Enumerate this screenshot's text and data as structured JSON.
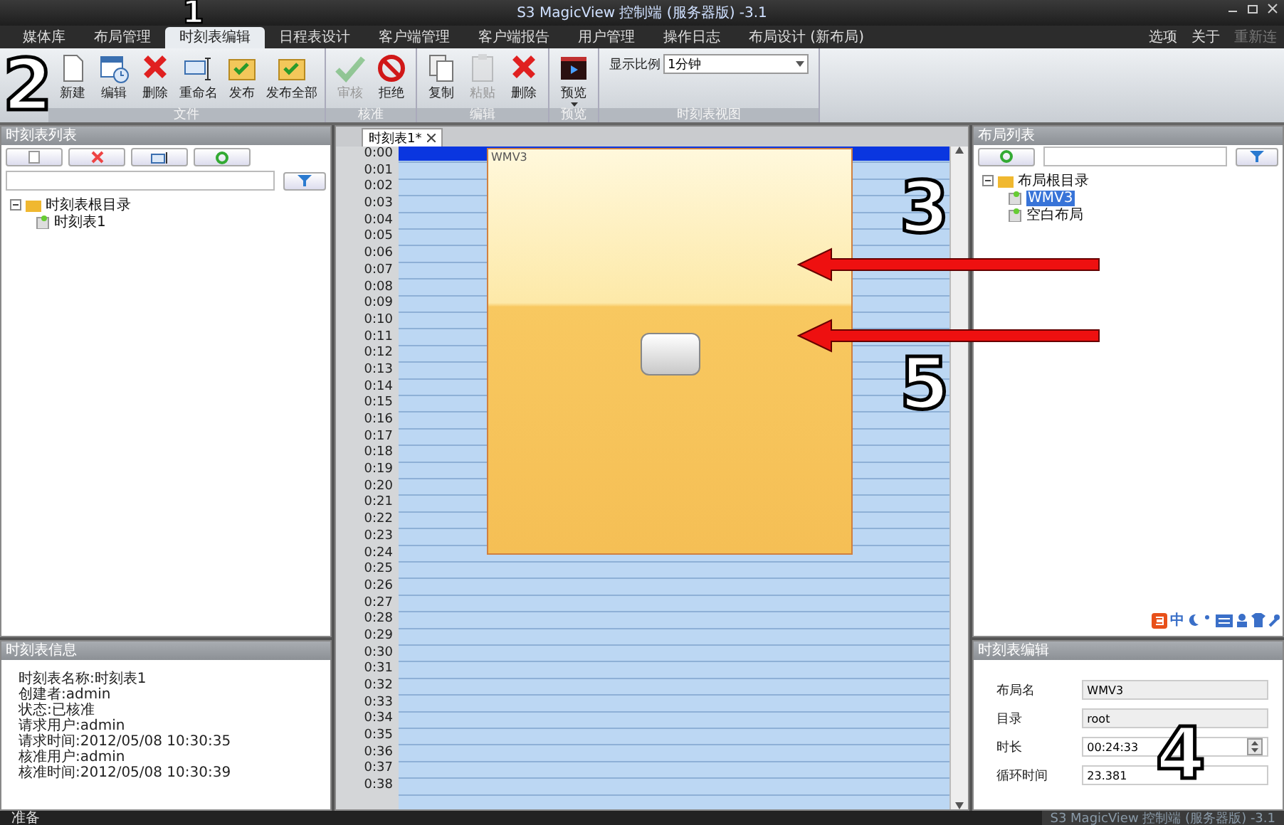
{
  "window": {
    "title": "S3 MagicView 控制端 (服务器版) -3.1"
  },
  "tabs": [
    {
      "label": "媒体库",
      "selected": false
    },
    {
      "label": "布局管理",
      "selected": false
    },
    {
      "label": "时刻表编辑",
      "selected": true
    },
    {
      "label": "日程表设计",
      "selected": false
    },
    {
      "label": "客户端管理",
      "selected": false
    },
    {
      "label": "客户端报告",
      "selected": false
    },
    {
      "label": "用户管理",
      "selected": false
    },
    {
      "label": "操作日志",
      "selected": false
    },
    {
      "label": "布局设计 (新布局)",
      "selected": false
    }
  ],
  "menu_right": [
    {
      "label": "选项",
      "disabled": false
    },
    {
      "label": "关于",
      "disabled": false
    },
    {
      "label": "重新连",
      "disabled": true
    }
  ],
  "ribbon": [
    {
      "label": "文件",
      "buttons": [
        {
          "label": "新建",
          "kind": "new",
          "disabled": false
        },
        {
          "label": "编辑",
          "kind": "edit",
          "disabled": false
        },
        {
          "label": "删除",
          "kind": "delete",
          "disabled": false
        },
        {
          "label": "重命名",
          "kind": "rename",
          "disabled": false
        },
        {
          "label": "发布",
          "kind": "publish",
          "disabled": false
        },
        {
          "label": "发布全部",
          "kind": "publish",
          "disabled": false
        }
      ]
    },
    {
      "label": "核准",
      "buttons": [
        {
          "label": "审核",
          "kind": "approve",
          "disabled": true
        },
        {
          "label": "拒绝",
          "kind": "reject",
          "disabled": false
        }
      ]
    },
    {
      "label": "编辑",
      "buttons": [
        {
          "label": "复制",
          "kind": "copy",
          "disabled": false
        },
        {
          "label": "粘贴",
          "kind": "paste",
          "disabled": true
        },
        {
          "label": "删除",
          "kind": "delete",
          "disabled": false
        }
      ]
    },
    {
      "label": "预览",
      "buttons": [
        {
          "label": "预览",
          "kind": "preview",
          "disabled": false
        }
      ]
    },
    {
      "label": "时刻表视图",
      "select": {
        "label": "显示比例",
        "value": "1分钟"
      }
    }
  ],
  "schedule_list": {
    "title": "时刻表列表",
    "tree": [
      {
        "label": "时刻表根目录",
        "expanded": true,
        "children": [
          {
            "label": "时刻表1",
            "selected": false
          }
        ]
      }
    ]
  },
  "schedule_info": {
    "title": "时刻表信息",
    "lines": [
      "时刻表名称:时刻表1",
      "创建者:admin",
      "状态:已核准",
      "请求用户:admin",
      "请求时间:2012/05/08 10:30:35",
      "核准用户:admin",
      "核准时间:2012/05/08 10:30:39"
    ]
  },
  "editor": {
    "tab": "时刻表1*",
    "times": [
      "0:00",
      "0:01",
      "0:02",
      "0:03",
      "0:04",
      "0:05",
      "0:06",
      "0:07",
      "0:08",
      "0:09",
      "0:10",
      "0:11",
      "0:12",
      "0:13",
      "0:14",
      "0:15",
      "0:16",
      "0:17",
      "0:18",
      "0:19",
      "0:20",
      "0:21",
      "0:22",
      "0:23",
      "0:24",
      "0:25",
      "0:26",
      "0:27",
      "0:28",
      "0:29",
      "0:30",
      "0:31",
      "0:32",
      "0:33",
      "0:34",
      "0:35",
      "0:36",
      "0:37",
      "0:38"
    ],
    "block": {
      "label": "WMV3"
    }
  },
  "layout_list": {
    "title": "布局列表",
    "tree": [
      {
        "label": "布局根目录",
        "expanded": true,
        "children": [
          {
            "label": "WMV3",
            "selected": true
          },
          {
            "label": "空白布局",
            "selected": false
          }
        ]
      }
    ]
  },
  "ime_bar": {
    "label": "中"
  },
  "schedule_edit": {
    "title": "时刻表编辑",
    "fields": [
      {
        "label": "布局名",
        "value": "WMV3",
        "kind": "readonly"
      },
      {
        "label": "目录",
        "value": "root",
        "kind": "readonly"
      },
      {
        "label": "时长",
        "value": "00:24:33",
        "kind": "spinner"
      },
      {
        "label": "循环时间",
        "value": "23.381",
        "kind": "text"
      }
    ]
  },
  "status_bar": {
    "left": "准备",
    "right": "S3 MagicView 控制端 (服务器版) -3.1"
  },
  "annotations": [
    {
      "kind": "number",
      "text": "1"
    },
    {
      "kind": "number",
      "text": "2"
    },
    {
      "kind": "number",
      "text": "3"
    },
    {
      "kind": "number",
      "text": "4"
    },
    {
      "kind": "number",
      "text": "5"
    },
    {
      "kind": "arrow"
    },
    {
      "kind": "arrow"
    }
  ]
}
